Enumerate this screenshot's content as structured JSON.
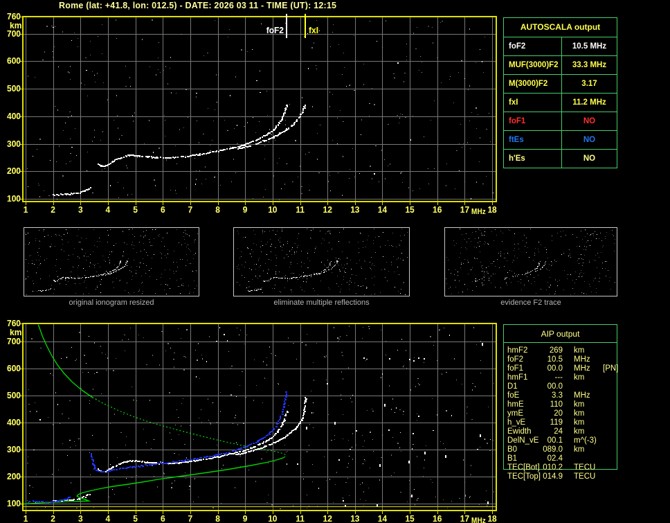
{
  "title": "Rome (lat: +41.8, lon: 012.5) - DATE: 2026 03 11 - TIME (UT): 12:15",
  "colors": {
    "background": "#000000",
    "title_text": "#ffffa0",
    "axis_text": "#ffff66",
    "plot_border": "#e0e000",
    "grid": "#787878",
    "table_border": "#46cf6c",
    "trace_white": "#ffffff",
    "fitted_trace_blue": "#2233ee",
    "profile_green": "#00d400",
    "marker_foF2": "#ffffff",
    "marker_fxI": "#ffff22",
    "caption_gray": "#b4b4b4"
  },
  "autoscala": {
    "header": "AUTOSCALA output",
    "rows": [
      {
        "label": "foF2",
        "value": "10.5 MHz",
        "color": "#ffffff"
      },
      {
        "label": "MUF(3000)F2",
        "value": "33.3 MHz",
        "color": "#ffff4d"
      },
      {
        "label": "M(3000)F2",
        "value": "3.17",
        "color": "#ffff4d"
      },
      {
        "label": "fxI",
        "value": "11.2 MHz",
        "color": "#ffff4d"
      },
      {
        "label": "foF1",
        "value": "NO",
        "color": "#ff3030"
      },
      {
        "label": "ftEs",
        "value": "NO",
        "color": "#2277ee"
      },
      {
        "label": "h'Es",
        "value": "NO",
        "color": "#ffff88"
      }
    ]
  },
  "aip": {
    "header": "AIP output",
    "rows": [
      {
        "label": "hmF2",
        "value": "269",
        "unit": "km",
        "note": ""
      },
      {
        "label": "foF2",
        "value": "10.5",
        "unit": "MHz",
        "note": ""
      },
      {
        "label": "foF1",
        "value": "00.0",
        "unit": "MHz",
        "note": "[PN]"
      },
      {
        "label": "hmF1",
        "value": "---",
        "unit": "km",
        "note": ""
      },
      {
        "label": "D1",
        "value": "00.0",
        "unit": "",
        "note": ""
      },
      {
        "label": "foE",
        "value": "3.3",
        "unit": "MHz",
        "note": ""
      },
      {
        "label": "hmE",
        "value": "110",
        "unit": "km",
        "note": ""
      },
      {
        "label": "ymE",
        "value": "20",
        "unit": "km",
        "note": ""
      },
      {
        "label": "h_vE",
        "value": "119",
        "unit": "km",
        "note": ""
      },
      {
        "label": "Ewidth",
        "value": "24",
        "unit": "km",
        "note": ""
      },
      {
        "label": "DelN_vE",
        "value": "00.1",
        "unit": "m^(-3)",
        "note": ""
      },
      {
        "label": "B0",
        "value": "089.0",
        "unit": "km",
        "note": ""
      },
      {
        "label": "B1",
        "value": "02.4",
        "unit": "",
        "note": ""
      },
      {
        "label": "TEC[Bot]",
        "value": "010.2",
        "unit": "TECU",
        "note": ""
      },
      {
        "label": "TEC[Top]",
        "value": "014.9",
        "unit": "TECU",
        "note": ""
      }
    ]
  },
  "thumbnails": [
    {
      "caption": "original ionogram resized"
    },
    {
      "caption": "eliminate multiple reflections"
    },
    {
      "caption": "evidence F2 trace"
    }
  ],
  "chart_data": [
    {
      "type": "scatter",
      "title": "scaled ionogram",
      "xlabel": "MHz",
      "ylabel": "km",
      "xlim": [
        1,
        18
      ],
      "ylim": [
        100,
        760
      ],
      "xticks": [
        1,
        2,
        3,
        4,
        5,
        6,
        7,
        8,
        9,
        10,
        11,
        12,
        13,
        14,
        15,
        16,
        17,
        18
      ],
      "yticks": [
        100,
        200,
        300,
        400,
        500,
        600,
        700,
        760
      ],
      "grid": true,
      "markers": [
        {
          "name": "foF2",
          "value": 10.5,
          "color": "#ffffff",
          "label_side": "left"
        },
        {
          "name": "fxI",
          "value": 11.2,
          "color": "#ffff22",
          "label_side": "right"
        }
      ],
      "series": [
        {
          "name": "E-trace",
          "style": "white-blocks",
          "points": [
            [
              2.0,
              116
            ],
            [
              2.2,
              117
            ],
            [
              2.45,
              119
            ],
            [
              2.7,
              121
            ],
            [
              2.9,
              124
            ],
            [
              3.1,
              130
            ],
            [
              3.25,
              136
            ],
            [
              3.35,
              142
            ]
          ]
        },
        {
          "name": "F-trace-ordinary",
          "style": "white-blocks",
          "points": [
            [
              3.62,
              230
            ],
            [
              3.7,
              222
            ],
            [
              3.8,
              219
            ],
            [
              3.95,
              223
            ],
            [
              4.15,
              237
            ],
            [
              4.4,
              250
            ],
            [
              4.65,
              258
            ],
            [
              4.85,
              261
            ],
            [
              5.1,
              258
            ],
            [
              5.4,
              255
            ],
            [
              5.75,
              252
            ],
            [
              6.1,
              251
            ],
            [
              6.5,
              253
            ],
            [
              6.9,
              257
            ],
            [
              7.3,
              263
            ],
            [
              7.7,
              270
            ],
            [
              8.1,
              278
            ],
            [
              8.5,
              287
            ],
            [
              8.9,
              297
            ],
            [
              9.2,
              308
            ],
            [
              9.5,
              321
            ],
            [
              9.75,
              334
            ],
            [
              9.95,
              348
            ],
            [
              10.1,
              362
            ],
            [
              10.22,
              377
            ],
            [
              10.32,
              394
            ],
            [
              10.4,
              412
            ],
            [
              10.46,
              428
            ],
            [
              10.5,
              442
            ]
          ]
        },
        {
          "name": "F-trace-extraordinary",
          "style": "white-blocks",
          "points": [
            [
              8.65,
              283
            ],
            [
              9.0,
              291
            ],
            [
              9.35,
              301
            ],
            [
              9.7,
              313
            ],
            [
              10.0,
              326
            ],
            [
              10.25,
              339
            ],
            [
              10.5,
              354
            ],
            [
              10.7,
              369
            ],
            [
              10.85,
              384
            ],
            [
              10.97,
              400
            ],
            [
              11.06,
              417
            ],
            [
              11.12,
              432
            ],
            [
              11.16,
              444
            ]
          ]
        }
      ]
    },
    {
      "type": "scatter",
      "title": "ionogram with AIP inversion (profile + fitted trace)",
      "xlabel": "MHz",
      "ylabel": "km",
      "xlim": [
        1,
        18
      ],
      "ylim": [
        100,
        760
      ],
      "xticks": [
        1,
        2,
        3,
        4,
        5,
        6,
        7,
        8,
        9,
        10,
        11,
        12,
        13,
        14,
        15,
        16,
        17,
        18
      ],
      "yticks": [
        100,
        200,
        300,
        400,
        500,
        600,
        700,
        760
      ],
      "grid": true,
      "markers": [],
      "series": [
        {
          "name": "E-trace",
          "style": "white-blocks",
          "points": [
            [
              2.0,
              112
            ],
            [
              2.3,
              114
            ],
            [
              2.6,
              116
            ],
            [
              2.9,
              119
            ],
            [
              3.1,
              126
            ],
            [
              3.3,
              136
            ]
          ]
        },
        {
          "name": "F-trace-ordinary",
          "style": "white-blocks",
          "points": [
            [
              3.62,
              230
            ],
            [
              3.7,
              222
            ],
            [
              3.8,
              219
            ],
            [
              3.95,
              223
            ],
            [
              4.15,
              237
            ],
            [
              4.4,
              250
            ],
            [
              4.65,
              258
            ],
            [
              4.85,
              261
            ],
            [
              5.1,
              258
            ],
            [
              5.4,
              255
            ],
            [
              5.75,
              252
            ],
            [
              6.1,
              251
            ],
            [
              6.5,
              253
            ],
            [
              6.9,
              257
            ],
            [
              7.3,
              263
            ],
            [
              7.7,
              270
            ],
            [
              8.1,
              278
            ],
            [
              8.5,
              287
            ],
            [
              8.9,
              297
            ],
            [
              9.2,
              308
            ],
            [
              9.5,
              321
            ],
            [
              9.75,
              334
            ],
            [
              9.95,
              348
            ],
            [
              10.1,
              362
            ],
            [
              10.22,
              377
            ],
            [
              10.32,
              394
            ],
            [
              10.4,
              412
            ],
            [
              10.46,
              428
            ],
            [
              10.5,
              445
            ]
          ]
        },
        {
          "name": "F-trace-extraordinary",
          "style": "white-blocks",
          "points": [
            [
              8.65,
              283
            ],
            [
              9.0,
              291
            ],
            [
              9.35,
              301
            ],
            [
              9.7,
              313
            ],
            [
              10.0,
              326
            ],
            [
              10.25,
              339
            ],
            [
              10.5,
              354
            ],
            [
              10.7,
              369
            ],
            [
              10.85,
              384
            ],
            [
              10.97,
              400
            ],
            [
              11.06,
              417
            ],
            [
              11.12,
              437
            ],
            [
              11.16,
              465
            ],
            [
              11.18,
              495
            ]
          ]
        },
        {
          "name": "fitted-trace-E",
          "style": "blue-blocks",
          "points": [
            [
              1.0,
              110
            ],
            [
              1.3,
              110
            ],
            [
              1.6,
              110
            ],
            [
              1.9,
              110
            ],
            [
              2.1,
              111
            ],
            [
              2.3,
              114
            ],
            [
              2.45,
              119
            ],
            [
              2.6,
              126
            ]
          ]
        },
        {
          "name": "fitted-trace-F",
          "style": "blue-blocks",
          "points": [
            [
              3.38,
              288
            ],
            [
              3.4,
              268
            ],
            [
              3.44,
              248
            ],
            [
              3.5,
              232
            ],
            [
              3.6,
              224
            ],
            [
              3.75,
              220
            ],
            [
              3.95,
              222
            ],
            [
              4.2,
              228
            ],
            [
              4.5,
              233
            ],
            [
              4.85,
              238
            ],
            [
              5.2,
              242
            ],
            [
              5.6,
              247
            ],
            [
              6.0,
              252
            ],
            [
              6.4,
              257
            ],
            [
              6.8,
              262
            ],
            [
              7.2,
              268
            ],
            [
              7.6,
              275
            ],
            [
              8.0,
              283
            ],
            [
              8.4,
              293
            ],
            [
              8.8,
              305
            ],
            [
              9.1,
              317
            ],
            [
              9.4,
              331
            ],
            [
              9.65,
              346
            ],
            [
              9.85,
              361
            ],
            [
              10.02,
              378
            ],
            [
              10.15,
              397
            ],
            [
              10.25,
              418
            ],
            [
              10.33,
              440
            ],
            [
              10.39,
              463
            ],
            [
              10.44,
              487
            ],
            [
              10.47,
              508
            ],
            [
              10.49,
              520
            ]
          ]
        },
        {
          "name": "density-profile-bottomside",
          "style": "green-solid",
          "points": [
            [
              0.85,
              98
            ],
            [
              1.3,
              101
            ],
            [
              1.8,
              104
            ],
            [
              2.3,
              106
            ],
            [
              2.75,
              108
            ],
            [
              3.1,
              109
            ],
            [
              3.3,
              110
            ],
            [
              3.15,
              116
            ],
            [
              2.97,
              122
            ],
            [
              2.87,
              128
            ],
            [
              2.92,
              134
            ],
            [
              3.07,
              140
            ],
            [
              3.35,
              147
            ],
            [
              3.75,
              156
            ],
            [
              4.2,
              164
            ],
            [
              4.7,
              171
            ],
            [
              5.2,
              179
            ],
            [
              5.85,
              190
            ],
            [
              6.7,
              202
            ],
            [
              7.55,
              214
            ],
            [
              8.4,
              227
            ],
            [
              9.2,
              241
            ],
            [
              9.8,
              253
            ],
            [
              10.2,
              263
            ],
            [
              10.42,
              271
            ]
          ]
        },
        {
          "name": "density-profile-topside-near-peak",
          "style": "green-dotted",
          "points": [
            [
              10.42,
              271
            ],
            [
              10.48,
              277
            ],
            [
              10.45,
              282
            ],
            [
              10.3,
              288
            ],
            [
              10.0,
              295
            ],
            [
              9.5,
              303
            ],
            [
              8.9,
              315
            ],
            [
              8.3,
              328
            ],
            [
              7.6,
              345
            ],
            [
              6.9,
              363
            ],
            [
              6.2,
              382
            ],
            [
              5.5,
              402
            ],
            [
              4.9,
              423
            ],
            [
              4.35,
              446
            ],
            [
              3.85,
              470
            ],
            [
              3.45,
              492
            ]
          ]
        },
        {
          "name": "density-profile-topside-upper",
          "style": "green-solid",
          "points": [
            [
              3.45,
              492
            ],
            [
              3.05,
              520
            ],
            [
              2.7,
              550
            ],
            [
              2.4,
              582
            ],
            [
              2.15,
              615
            ],
            [
              1.95,
              648
            ],
            [
              1.78,
              682
            ],
            [
              1.62,
              718
            ],
            [
              1.5,
              752
            ],
            [
              1.46,
              762
            ]
          ]
        }
      ]
    }
  ]
}
